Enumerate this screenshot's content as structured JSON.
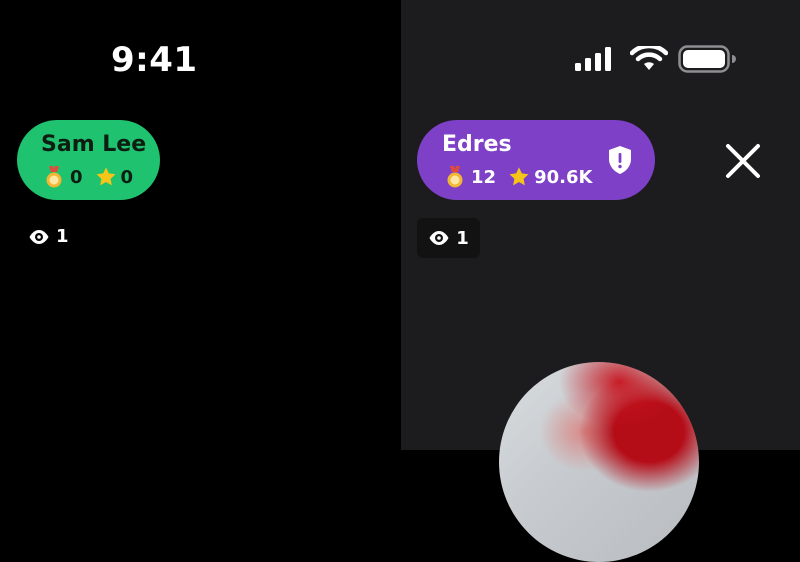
{
  "status_bar": {
    "time": "9:41"
  },
  "left_panel": {
    "user": {
      "name": "Sam Lee",
      "medals": "0",
      "stars": "0",
      "pill_color": "#1fc26e"
    },
    "viewers": "1"
  },
  "right_panel": {
    "user": {
      "name": "Edres",
      "medals": "12",
      "stars": "90.6K",
      "pill_color": "#7e40c6",
      "badge_icon": "shield-alert-icon"
    },
    "viewers": "1",
    "close_icon": "close-icon"
  },
  "colors": {
    "left_background": "#000000",
    "right_background": "#1c1c1e",
    "star": "#f5c518",
    "medal": "#f2b833"
  }
}
